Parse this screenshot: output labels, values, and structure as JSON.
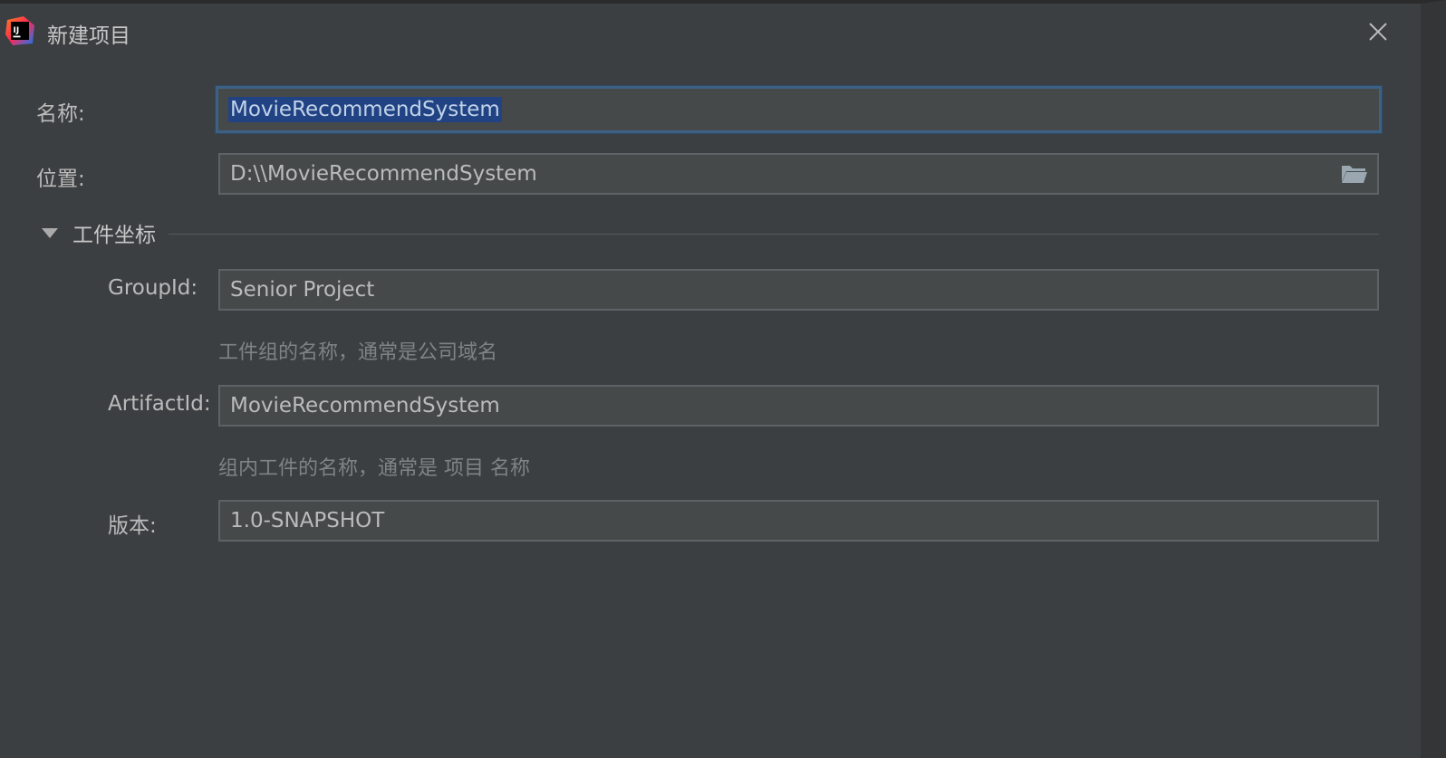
{
  "window": {
    "title": "新建项目",
    "logo_icon": "intellij-idea-icon",
    "close_icon": "close-icon"
  },
  "form": {
    "name": {
      "label": "名称:",
      "value": "MovieRecommendSystem"
    },
    "location": {
      "label": "位置:",
      "value": "D:\\\\MovieRecommendSystem",
      "browse_icon": "folder-icon"
    },
    "artifact_section": {
      "title": "工件坐标",
      "expanded": true,
      "group_id": {
        "label": "GroupId:",
        "value": "Senior Project",
        "hint": "工件组的名称，通常是公司域名"
      },
      "artifact_id": {
        "label": "ArtifactId:",
        "value": "MovieRecommendSystem",
        "hint": "组内工件的名称，通常是 项目 名称"
      },
      "version": {
        "label": "版本:",
        "value": "1.0-SNAPSHOT"
      }
    }
  },
  "colors": {
    "background": "#3c3f41",
    "field_background": "#45494a",
    "focus_border": "#3d6185",
    "selection": "#214283"
  }
}
